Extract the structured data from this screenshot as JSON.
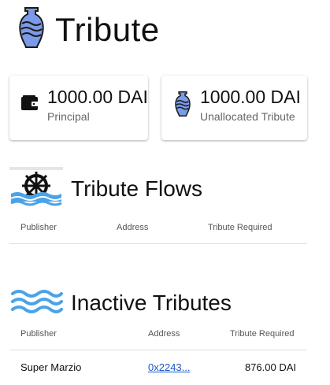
{
  "app": {
    "title": "Tribute",
    "logo_icon": "tribute-vase-icon"
  },
  "cards": [
    {
      "icon": "wallet-icon",
      "amount": "1000.00 DAI",
      "caption": "Principal"
    },
    {
      "icon": "tribute-vase-icon",
      "amount": "1000.00 DAI",
      "caption": "Unallocated Tribute"
    }
  ],
  "flows": {
    "title": "Tribute Flows",
    "icon": "water-wheel-icon",
    "columns": [
      "Publisher",
      "Address",
      "Tribute Required"
    ],
    "rows": []
  },
  "inactive": {
    "title": "Inactive Tributes",
    "icon": "waves-icon",
    "columns": [
      "Publisher",
      "Address",
      "Tribute Required"
    ],
    "rows": [
      {
        "publisher": "Super Marzio",
        "address": "0x2243...",
        "tribute_required": "876.00 DAI"
      }
    ]
  },
  "colors": {
    "vase_blue": "#7b9be8",
    "water_blue": "#4aa3e8",
    "link_blue": "#1a57c8"
  }
}
